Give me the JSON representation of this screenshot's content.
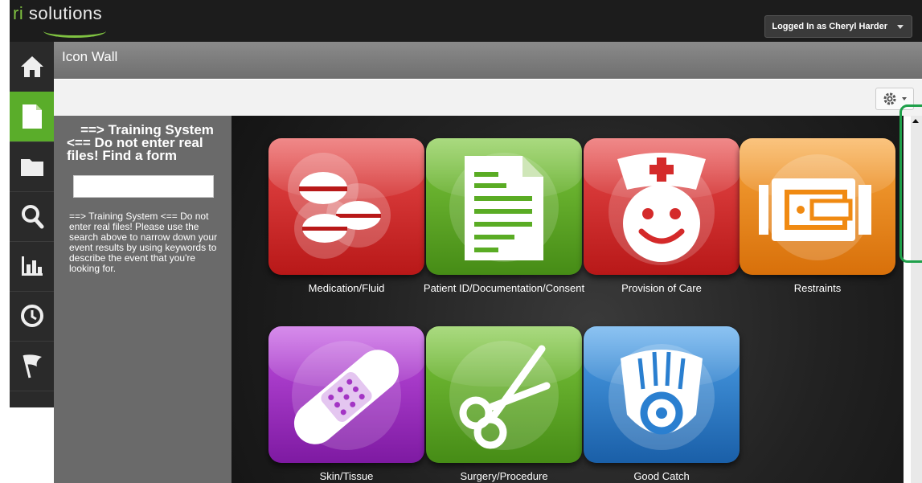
{
  "header": {
    "logo_ri": "ri",
    "logo_text": " solutions",
    "user_label": "Logged In as Cheryl Harder"
  },
  "sidebar": {
    "items": [
      {
        "icon": "home-icon",
        "active": false
      },
      {
        "icon": "document-icon",
        "active": true
      },
      {
        "icon": "folder-icon",
        "active": false
      },
      {
        "icon": "search-icon",
        "active": false
      },
      {
        "icon": "bar-chart-icon",
        "active": false
      },
      {
        "icon": "clock-icon",
        "active": false
      },
      {
        "icon": "flag-icon",
        "active": false
      }
    ]
  },
  "panel": {
    "title": "Icon Wall"
  },
  "left_panel": {
    "heading_line1": "==> Training System",
    "heading_line2": "<== Do not enter real files! Find a form",
    "help_text": "==> Training System <== Do not enter real files! Please use the search above to narrow down your event results by using keywords to describe the event that you're looking for."
  },
  "tiles": [
    {
      "label": "Medication/Fluid",
      "color": "#d42a2a",
      "icon": "pills-icon"
    },
    {
      "label": "Patient ID/Documentation/Consent",
      "color": "#5aac24",
      "icon": "document-icon"
    },
    {
      "label": "Provision of Care",
      "color": "#d42a2a",
      "icon": "nurse-icon"
    },
    {
      "label": "Restraints",
      "color": "#f08a12",
      "icon": "restraint-icon"
    },
    {
      "label": "Skin/Tissue",
      "color": "#a334c4",
      "icon": "bandage-icon"
    },
    {
      "label": "Surgery/Procedure",
      "color": "#5aac24",
      "icon": "scissors-icon"
    },
    {
      "label": "Good Catch",
      "color": "#2a7fd0",
      "icon": "glove-icon"
    }
  ]
}
